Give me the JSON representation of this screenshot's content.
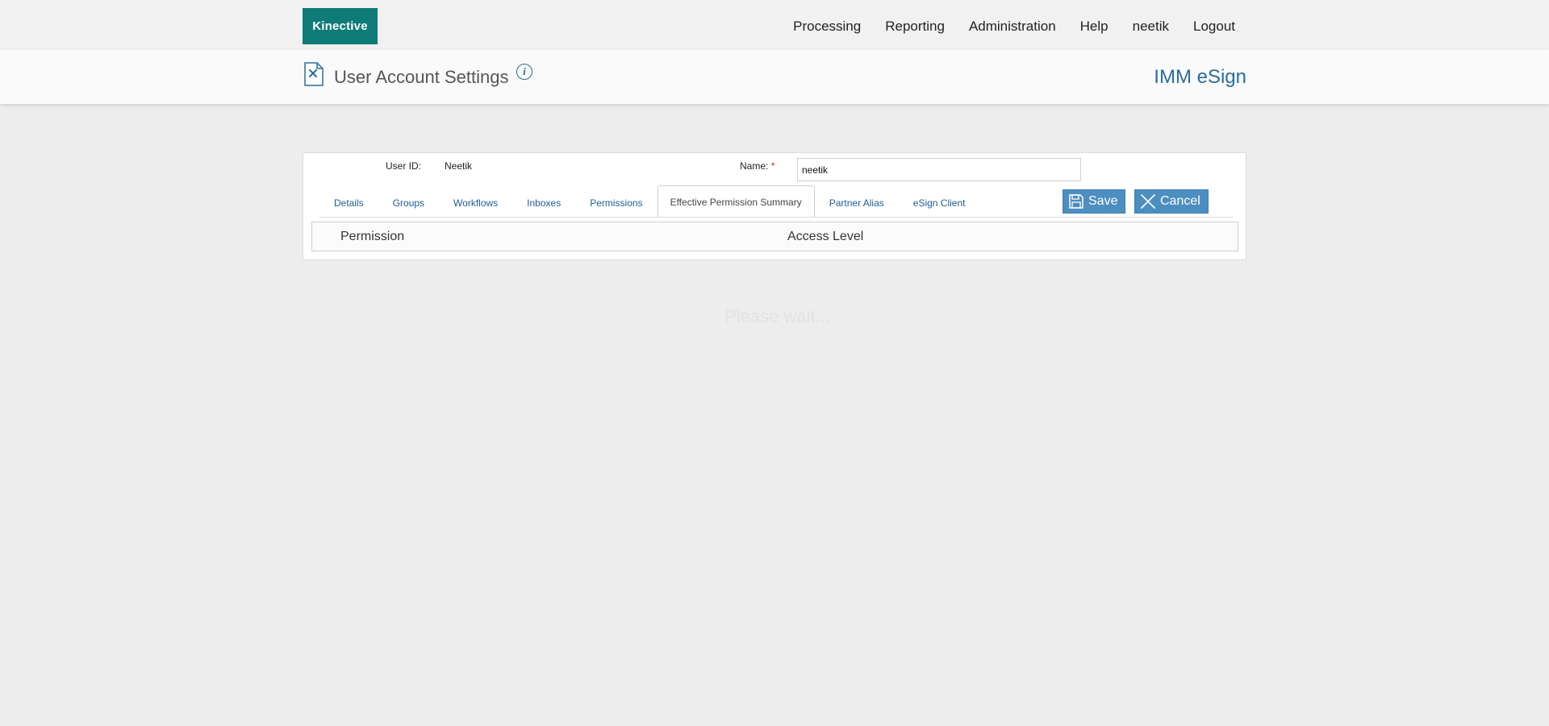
{
  "brand": {
    "logo_text": "Kinective"
  },
  "nav": {
    "items": [
      "Processing",
      "Reporting",
      "Administration",
      "Help",
      "neetik",
      "Logout"
    ]
  },
  "header": {
    "title": "User Account Settings",
    "product": "IMM eSign"
  },
  "form": {
    "user_id_label": "User ID:",
    "user_id_value": "Neetik",
    "name_label": "Name:",
    "required_mark": "*",
    "name_value": "neetik"
  },
  "tabs": [
    {
      "label": "Details"
    },
    {
      "label": "Groups"
    },
    {
      "label": "Workflows"
    },
    {
      "label": "Inboxes"
    },
    {
      "label": "Permissions"
    },
    {
      "label": "Effective Permission Summary",
      "active": true
    },
    {
      "label": "Partner Alias"
    },
    {
      "label": "eSign Client"
    }
  ],
  "actions": {
    "save_label": "Save",
    "cancel_label": "Cancel"
  },
  "table": {
    "columns": [
      "Permission",
      "Access Level"
    ]
  },
  "overlay": {
    "text": "Please wait..."
  },
  "colors": {
    "brand": "#0e7b77",
    "link": "#1e5d96",
    "button": "#4d8ec1",
    "required": "#d42a2a"
  }
}
